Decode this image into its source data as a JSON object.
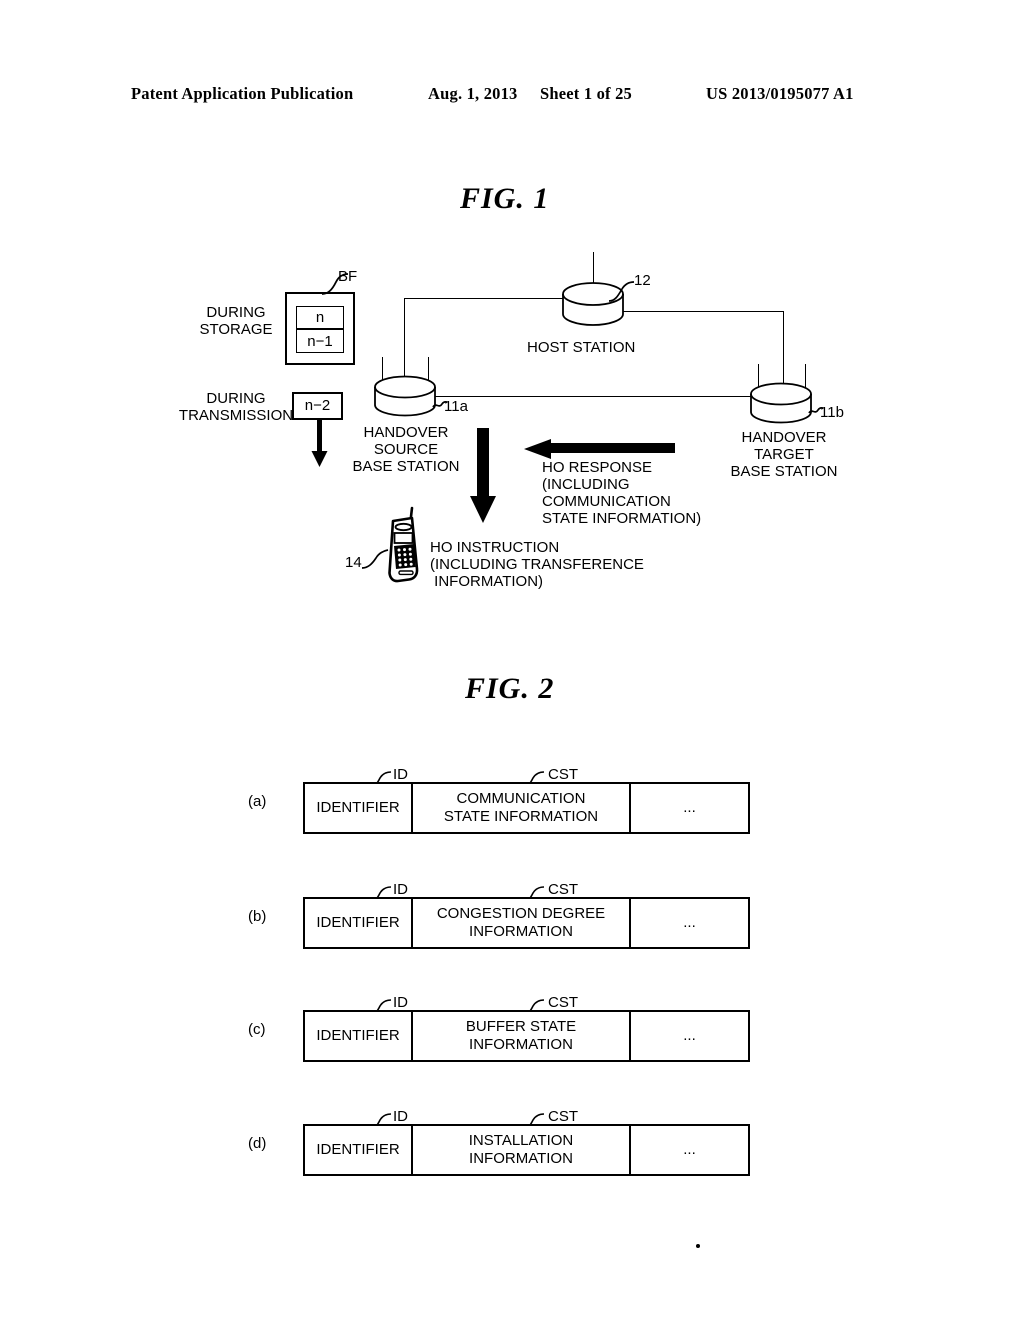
{
  "header": {
    "publication": "Patent Application Publication",
    "date": "Aug. 1, 2013",
    "sheet": "Sheet 1 of 25",
    "number": "US 2013/0195077 A1"
  },
  "fig1": {
    "title": "FIG. 1",
    "labels": {
      "during_storage": "DURING\nSTORAGE",
      "during_transmission": "DURING\nTRANSMISSION",
      "bf": "BF",
      "buffer_top": "n",
      "buffer_bottom": "n−1",
      "transmit_packet": "n−2",
      "host_station": "HOST STATION",
      "host_station_ref": "12",
      "source_bs": "HANDOVER\nSOURCE\nBASE STATION",
      "source_bs_ref": "11a",
      "target_bs": "HANDOVER\nTARGET\nBASE STATION",
      "target_bs_ref": "11b",
      "mobile_ref": "14",
      "ho_response": "HO RESPONSE\n(INCLUDING\nCOMMUNICATION\nSTATE INFORMATION)",
      "ho_instruction": "HO INSTRUCTION\n(INCLUDING TRANSFERENCE\n INFORMATION)"
    }
  },
  "fig2": {
    "title": "FIG. 2",
    "tag_id": "ID",
    "tag_cst": "CST",
    "ellipsis": "...",
    "rows": [
      {
        "letter": "(a)",
        "identifier": "IDENTIFIER",
        "content": "COMMUNICATION\nSTATE INFORMATION",
        "rest": "..."
      },
      {
        "letter": "(b)",
        "identifier": "IDENTIFIER",
        "content": "CONGESTION DEGREE\nINFORMATION",
        "rest": "..."
      },
      {
        "letter": "(c)",
        "identifier": "IDENTIFIER",
        "content": "BUFFER STATE\nINFORMATION",
        "rest": "..."
      },
      {
        "letter": "(d)",
        "identifier": "IDENTIFIER",
        "content": "INSTALLATION\nINFORMATION",
        "rest": "..."
      }
    ]
  }
}
